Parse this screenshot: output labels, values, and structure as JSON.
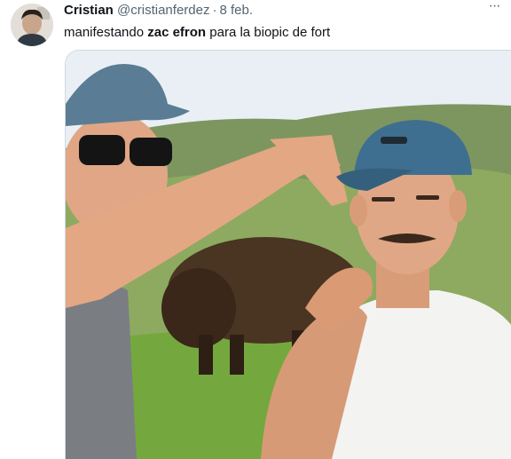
{
  "tweet": {
    "display_name": "Cristian",
    "handle": "@cristianferdez",
    "separator": "·",
    "date": "8 feb.",
    "text_before": "manifestando ",
    "text_bold": "zac efron",
    "text_after": " para la biopic de fort",
    "more_icon": "more-horizontal-icon"
  },
  "colors": {
    "name": "#0f1419",
    "muted": "#536471",
    "sky": "#eaf1f7",
    "grass": "#6d9a3c"
  }
}
